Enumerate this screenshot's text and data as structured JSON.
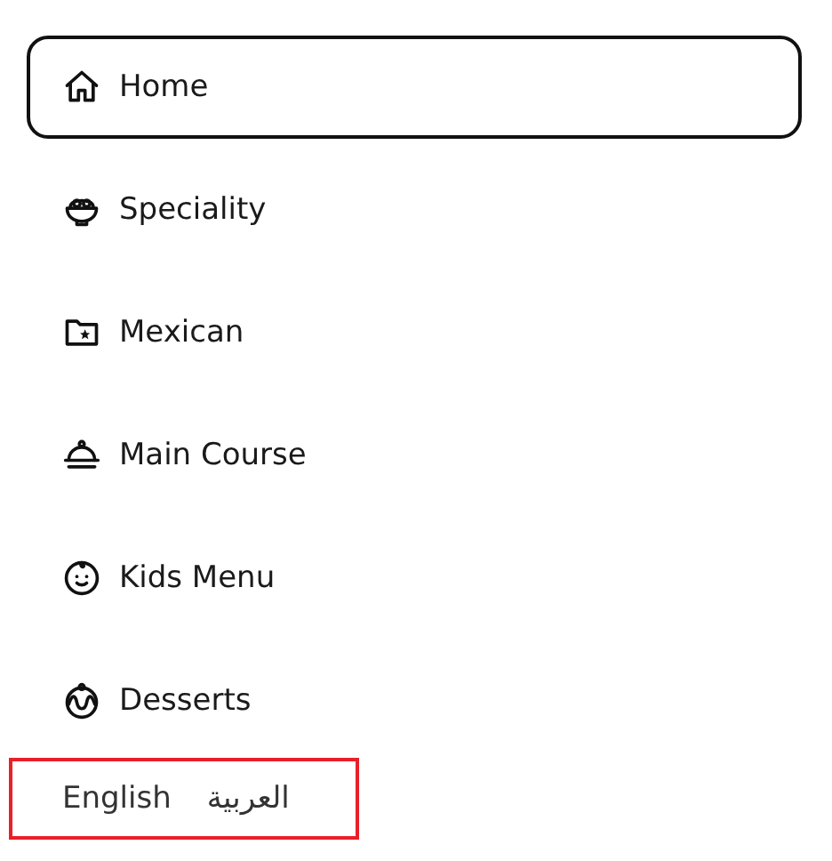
{
  "menu": {
    "items": [
      {
        "label": "Home",
        "selected": true
      },
      {
        "label": "Speciality",
        "selected": false
      },
      {
        "label": "Mexican",
        "selected": false
      },
      {
        "label": "Main Course",
        "selected": false
      },
      {
        "label": "Kids Menu",
        "selected": false
      },
      {
        "label": "Desserts",
        "selected": false
      }
    ]
  },
  "languages": [
    "English",
    "العربية"
  ]
}
